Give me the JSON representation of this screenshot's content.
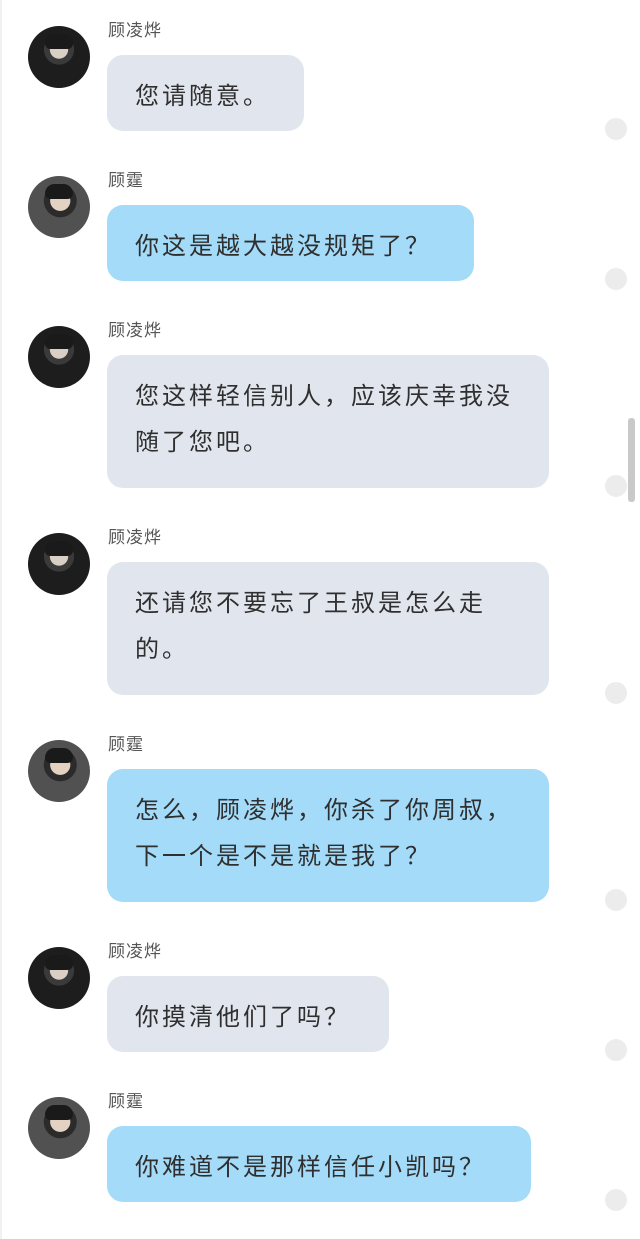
{
  "messages": [
    {
      "sender": "顾凌烨",
      "text": "您请随意。",
      "style": "gray",
      "avatar": "avatar-ling-ye"
    },
    {
      "sender": "顾霆",
      "text": "你这是越大越没规矩了？",
      "style": "blue",
      "avatar": "avatar-ting"
    },
    {
      "sender": "顾凌烨",
      "text": "您这样轻信别人，应该庆幸我没随了您吧。",
      "style": "gray",
      "avatar": "avatar-ling-ye"
    },
    {
      "sender": "顾凌烨",
      "text": "还请您不要忘了王叔是怎么走的。",
      "style": "gray",
      "avatar": "avatar-ling-ye"
    },
    {
      "sender": "顾霆",
      "text": "怎么，顾凌烨，你杀了你周叔，下一个是不是就是我了？",
      "style": "blue",
      "avatar": "avatar-ting"
    },
    {
      "sender": "顾凌烨",
      "text": "你摸清他们了吗？",
      "style": "gray",
      "avatar": "avatar-ling-ye"
    },
    {
      "sender": "顾霆",
      "text": "你难道不是那样信任小凯吗？",
      "style": "blue",
      "avatar": "avatar-ting"
    }
  ],
  "colors": {
    "bubble_gray": "#e1e6ee",
    "bubble_blue": "#a3dbf8",
    "status_dot": "#ececec"
  }
}
